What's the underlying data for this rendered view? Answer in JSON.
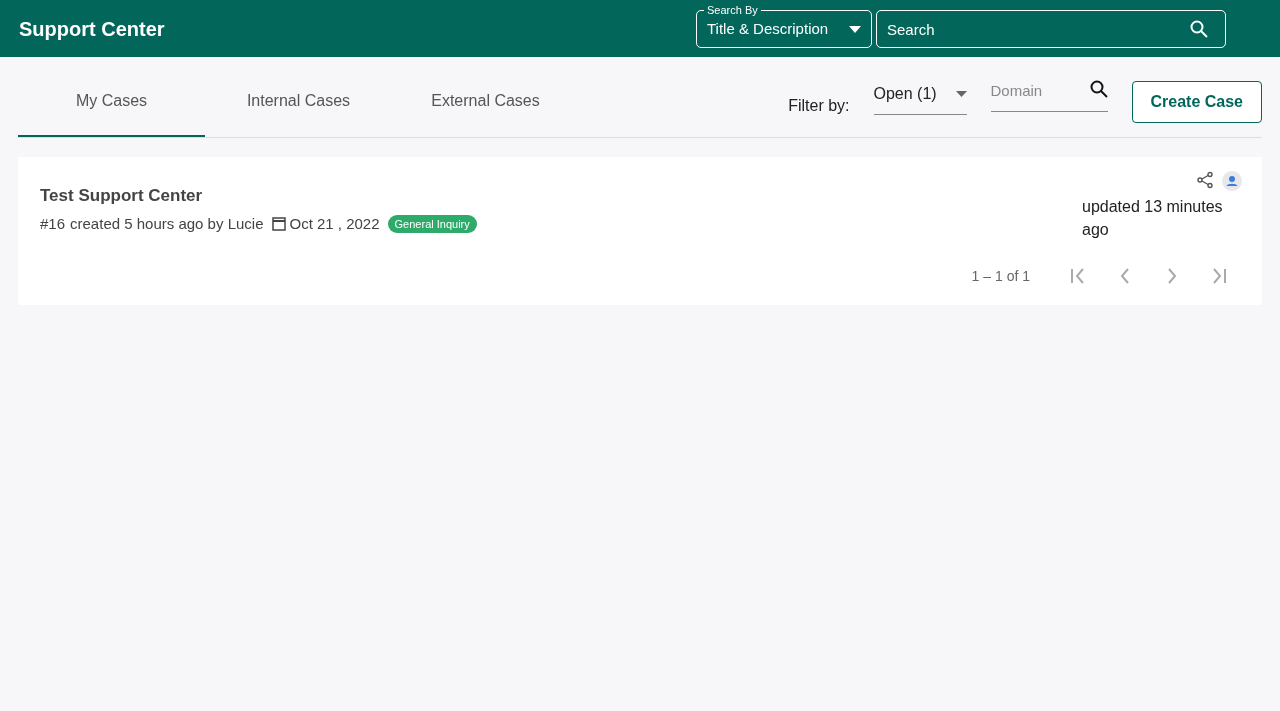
{
  "header": {
    "title": "Support Center",
    "search_by": {
      "label": "Search By",
      "value": "Title & Description"
    },
    "search": {
      "placeholder": "Search"
    }
  },
  "tabs": [
    {
      "label": "My Cases",
      "selected": true
    },
    {
      "label": "Internal Cases",
      "selected": false
    },
    {
      "label": "External Cases",
      "selected": false
    }
  ],
  "filter": {
    "label": "Filter by:",
    "status": "Open (1)",
    "domain_placeholder": "Domain"
  },
  "create_button": "Create Case",
  "cases": [
    {
      "title": "Test Support Center",
      "number": "#16",
      "created": "created 5 hours ago by Lucie",
      "date": "Oct 21 , 2022",
      "tag": {
        "label": "General Inquiry",
        "color": "#2eaa6b"
      },
      "updated": "updated 13 minutes ago"
    }
  ],
  "pagination": {
    "range": "1 – 1 of 1",
    "buttons": [
      {
        "kind": "first",
        "disabled": true
      },
      {
        "kind": "prev",
        "disabled": true
      },
      {
        "kind": "next",
        "disabled": true
      },
      {
        "kind": "last",
        "disabled": true
      }
    ]
  }
}
